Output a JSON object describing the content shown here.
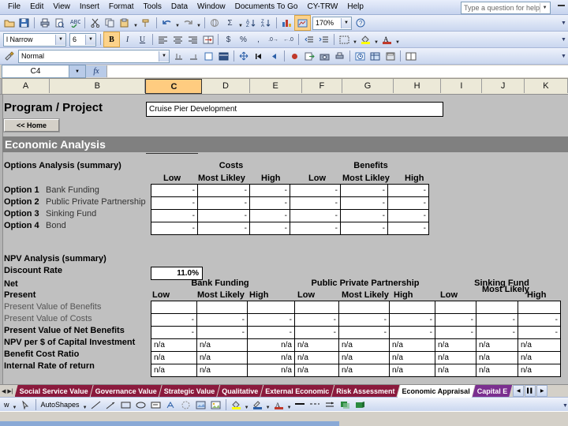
{
  "window": {
    "help_placeholder": "Type a question for help"
  },
  "menu": {
    "items": [
      "File",
      "Edit",
      "View",
      "Insert",
      "Format",
      "Tools",
      "Data",
      "Window",
      "Documents To Go",
      "CY-TRW",
      "Help"
    ]
  },
  "standard_toolbar": {
    "zoom_value": "170%",
    "buttons": [
      "open-icon",
      "save-icon",
      "print-icon",
      "print-preview-icon",
      "spelling-icon",
      "cut-icon",
      "copy-icon",
      "paste-icon",
      "format-painter-icon",
      "undo-icon",
      "redo-icon",
      "hyperlink-icon",
      "autosum-icon",
      "sort-ascending-icon",
      "sort-descending-icon",
      "chart-wizard-icon",
      "drawing-icon",
      "help-icon"
    ]
  },
  "formatting_toolbar": {
    "font_name": "l Narrow",
    "font_size": "6",
    "bold_label": "B",
    "italic_label": "I",
    "underline_label": "U"
  },
  "style_toolbar": {
    "style_name": "Normal"
  },
  "formula_bar": {
    "name_box": "C4",
    "fx_label": "fx",
    "formula": ""
  },
  "grid": {
    "columns": [
      "A",
      "B",
      "C",
      "D",
      "E",
      "F",
      "G",
      "H",
      "I",
      "J",
      "K"
    ],
    "selected_column": "C"
  },
  "content": {
    "program_label": "Program / Project",
    "program_value": "Cruise Pier Development",
    "home_button": "<< Home",
    "section_title": "Economic Analysis",
    "options_analysis": {
      "title": "Options Analysis (summary)",
      "group_headers": [
        "Costs",
        "Benefits"
      ],
      "sub_headers": [
        "Low",
        "Most Likley",
        "High"
      ],
      "rows": [
        {
          "option": "Option 1",
          "name": "Bank Funding",
          "cells": [
            "-",
            "-",
            "-",
            "-",
            "-",
            "-"
          ]
        },
        {
          "option": "Option 2",
          "name": "Public Private Partnership",
          "cells": [
            "-",
            "-",
            "-",
            "-",
            "-",
            "-"
          ]
        },
        {
          "option": "Option 3",
          "name": "Sinking Fund",
          "cells": [
            "-",
            "-",
            "-",
            "-",
            "-",
            "-"
          ]
        },
        {
          "option": "Option 4",
          "name": "Bond",
          "cells": [
            "-",
            "-",
            "-",
            "-",
            "-",
            "-"
          ]
        }
      ]
    },
    "npv_analysis": {
      "title": "NPV Analysis (summary)",
      "discount_rate_label": "Discount Rate",
      "discount_rate_value": "11.0%",
      "net_label": "Net",
      "present_label": "Present",
      "group_headers": [
        "Bank Funding",
        "Public Private Partnership",
        "Sinking Fund"
      ],
      "sub_headers": [
        "Low",
        "Most Likely",
        "High"
      ],
      "sinking_sub_headers": [
        "Low",
        "Most Likely",
        "High"
      ],
      "row_labels": [
        "Present Value of Benefits",
        "Present Value of Costs",
        "Present Value of Net Benefits",
        "NPV per $ of Capital Investment",
        "Benefit Cost Ratio",
        "Internal Rate of return"
      ],
      "rows": [
        [
          "",
          "",
          "",
          "",
          "",
          "",
          "",
          "",
          ""
        ],
        [
          "-",
          "-",
          "-",
          "-",
          "-",
          "-",
          "-",
          "-",
          "-"
        ],
        [
          "-",
          "-",
          "-",
          "-",
          "-",
          "-",
          "-",
          "-",
          "-"
        ],
        [
          "n/a",
          "n/a",
          "n/a",
          "n/a",
          "n/a",
          "n/a",
          "n/a",
          "n/a",
          "n/a"
        ],
        [
          "n/a",
          "n/a",
          "n/a",
          "n/a",
          "n/a",
          "n/a",
          "n/a",
          "n/a",
          "n/a"
        ],
        [
          "n/a",
          "n/a",
          "n/a",
          "n/a",
          "n/a",
          "n/a",
          "n/a",
          "n/a",
          "n/a"
        ]
      ]
    }
  },
  "sheet_tabs": {
    "tabs": [
      {
        "label": "Social Service Value",
        "active": false,
        "color": "#8b1a3d"
      },
      {
        "label": "Governance Value",
        "active": false,
        "color": "#8b1a3d"
      },
      {
        "label": "Strategic Value",
        "active": false,
        "color": "#8b1a3d"
      },
      {
        "label": "Qualitative",
        "active": false,
        "color": "#8b1a3d"
      },
      {
        "label": "External Economic",
        "active": false,
        "color": "#8b1a3d"
      },
      {
        "label": "Risk Assessment",
        "active": false,
        "color": "#8b1a3d"
      },
      {
        "label": "Economic Appraisal",
        "active": true,
        "color": "#ffffff"
      },
      {
        "label": "Capital E",
        "active": false,
        "color": "#7b2f8f"
      }
    ]
  },
  "drawing_toolbar": {
    "draw_label": "w",
    "autoshapes_label": "AutoShapes"
  },
  "colors": {
    "sheet_background": "#c0c0c0",
    "section_bar": "#808080",
    "selected_column": "#ffcc80",
    "tab_maroon": "#8b1a3d",
    "tab_purple": "#7b2f8f"
  }
}
